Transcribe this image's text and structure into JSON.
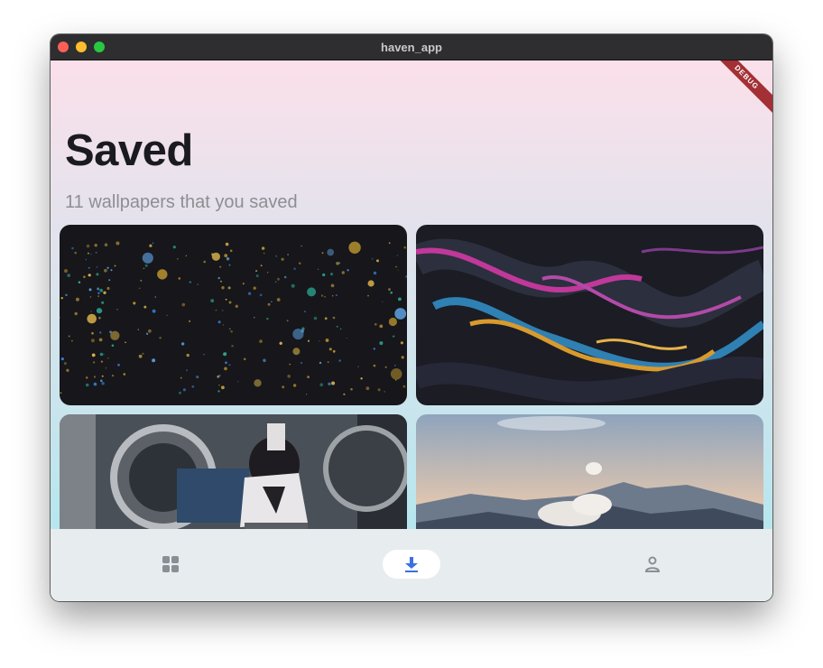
{
  "window": {
    "title": "haven_app"
  },
  "debug_banner": "DEBUG",
  "page": {
    "title": "Saved",
    "subtitle": "11 wallpapers that you saved"
  },
  "wallpapers": [
    {
      "subject": "dark network graph with colorful dots"
    },
    {
      "subject": "abstract swirling dark marble with pink, blue and gold"
    },
    {
      "subject": "girl in school uniform among metal machinery"
    },
    {
      "subject": "volcanic mountains with smoke at dawn"
    }
  ],
  "nav": {
    "items": [
      {
        "icon": "grid-icon",
        "active": false
      },
      {
        "icon": "download-icon",
        "active": true
      },
      {
        "icon": "person-icon",
        "active": false
      }
    ],
    "active_color": "#3b6fe6",
    "inactive_color": "#8a8f95"
  }
}
